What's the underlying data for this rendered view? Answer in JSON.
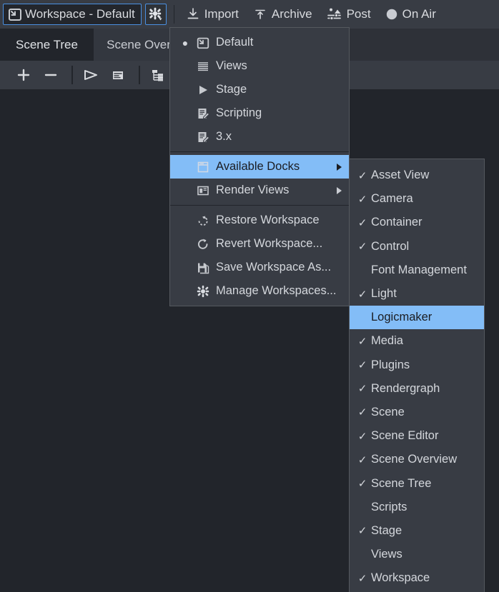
{
  "toolbar": {
    "workspace_button": {
      "label": "Workspace - Default",
      "icon": "workspace-icon"
    },
    "gear_button": {
      "icon": "gear-dropdown-icon"
    },
    "items": [
      {
        "label": "Import",
        "icon": "import-icon"
      },
      {
        "label": "Archive",
        "icon": "archive-icon"
      },
      {
        "label": "Post",
        "icon": "post-sliders-icon"
      },
      {
        "label": "On Air",
        "icon": "on-air-circle-icon"
      }
    ]
  },
  "tabs": [
    {
      "label": "Scene Tree",
      "active": true
    },
    {
      "label": "Scene Overview",
      "active": false
    }
  ],
  "panel_toolbar": {
    "icons": [
      "add-icon",
      "remove-icon",
      "play-icon",
      "list-icon",
      "tree-icon"
    ]
  },
  "workspace_menu": {
    "groups": [
      {
        "items": [
          {
            "label": "Default",
            "icon": "workspace-icon",
            "radio": true,
            "selected": false
          },
          {
            "label": "Views",
            "icon": "views-lines-icon",
            "radio": false,
            "selected": false
          },
          {
            "label": "Stage",
            "icon": "stage-play-icon",
            "radio": false,
            "selected": false
          },
          {
            "label": "Scripting",
            "icon": "script-edit-icon",
            "radio": false,
            "selected": false
          },
          {
            "label": "3.x",
            "icon": "script-edit-icon",
            "radio": false,
            "selected": false
          }
        ]
      },
      {
        "items": [
          {
            "label": "Available Docks",
            "icon": "dock-window-icon",
            "submenu": true,
            "selected": true
          },
          {
            "label": "Render Views",
            "icon": "render-view-icon",
            "submenu": true,
            "selected": false
          }
        ]
      },
      {
        "items": [
          {
            "label": "Restore Workspace",
            "icon": "restore-icon",
            "selected": false
          },
          {
            "label": "Revert Workspace...",
            "icon": "revert-icon",
            "selected": false
          },
          {
            "label": "Save Workspace As...",
            "icon": "save-icon",
            "selected": false
          },
          {
            "label": "Manage Workspaces...",
            "icon": "gear-icon",
            "selected": false
          }
        ]
      }
    ]
  },
  "available_docks_submenu": {
    "items": [
      {
        "label": "Asset View",
        "checked": true,
        "selected": false
      },
      {
        "label": "Camera",
        "checked": true,
        "selected": false
      },
      {
        "label": "Container",
        "checked": true,
        "selected": false
      },
      {
        "label": "Control",
        "checked": true,
        "selected": false
      },
      {
        "label": "Font Management",
        "checked": false,
        "selected": false
      },
      {
        "label": "Light",
        "checked": true,
        "selected": false
      },
      {
        "label": "Logicmaker",
        "checked": false,
        "selected": true
      },
      {
        "label": "Media",
        "checked": true,
        "selected": false
      },
      {
        "label": "Plugins",
        "checked": true,
        "selected": false
      },
      {
        "label": "Rendergraph",
        "checked": true,
        "selected": false
      },
      {
        "label": "Scene",
        "checked": true,
        "selected": false
      },
      {
        "label": "Scene Editor",
        "checked": true,
        "selected": false
      },
      {
        "label": "Scene Overview",
        "checked": true,
        "selected": false
      },
      {
        "label": "Scene Tree",
        "checked": true,
        "selected": false
      },
      {
        "label": "Scripts",
        "checked": false,
        "selected": false
      },
      {
        "label": "Stage",
        "checked": true,
        "selected": false
      },
      {
        "label": "Views",
        "checked": false,
        "selected": false
      },
      {
        "label": "Workspace",
        "checked": true,
        "selected": false
      }
    ]
  },
  "colors": {
    "toolbar_bg": "#383c44",
    "panel_bg": "#22252b",
    "menu_bg": "#383c44",
    "highlight": "#83bdf7",
    "focus_border": "#4a90e2",
    "text": "#d4d7dc"
  },
  "checkmark_glyph": "✓",
  "radio_glyph": "●"
}
